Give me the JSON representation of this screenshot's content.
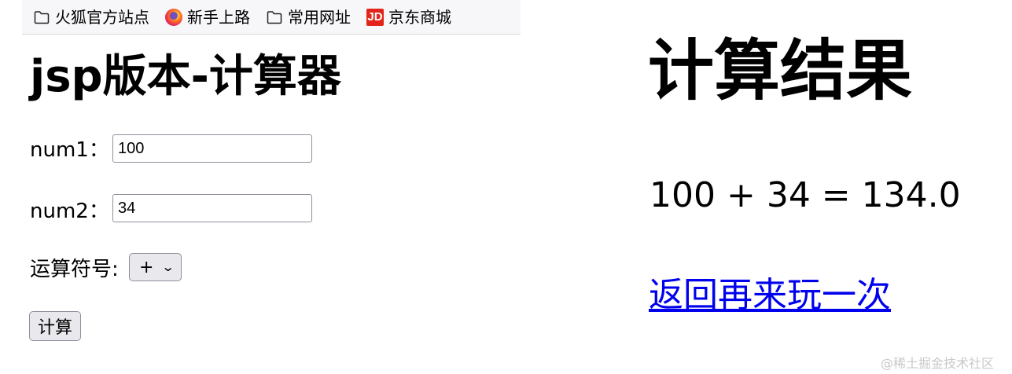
{
  "bookmarks": {
    "items": [
      {
        "label": "火狐官方站点",
        "icon": "folder-icon"
      },
      {
        "label": "新手上路",
        "icon": "firefox-icon"
      },
      {
        "label": "常用网址",
        "icon": "folder-icon"
      },
      {
        "label": "京东商城",
        "icon": "jd-logo-icon",
        "icon_text": "JD"
      }
    ]
  },
  "calculator": {
    "title": "jsp版本-计算器",
    "num1_label": "num1：",
    "num1_value": "100",
    "num2_label": "num2：",
    "num2_value": "34",
    "operator_label": "运算符号:",
    "operator_selected": "+",
    "submit_label": "计算"
  },
  "result": {
    "title": "计算结果",
    "expression": "100 + 34 = 134.0",
    "back_link": "返回再来玩一次"
  },
  "watermark": "@稀土掘金技术社区",
  "colors": {
    "link": "#0000ee",
    "bookmark_bar": "#f7f7f9",
    "jd_red": "#e1251b",
    "button_bg": "#e9e9ed"
  }
}
